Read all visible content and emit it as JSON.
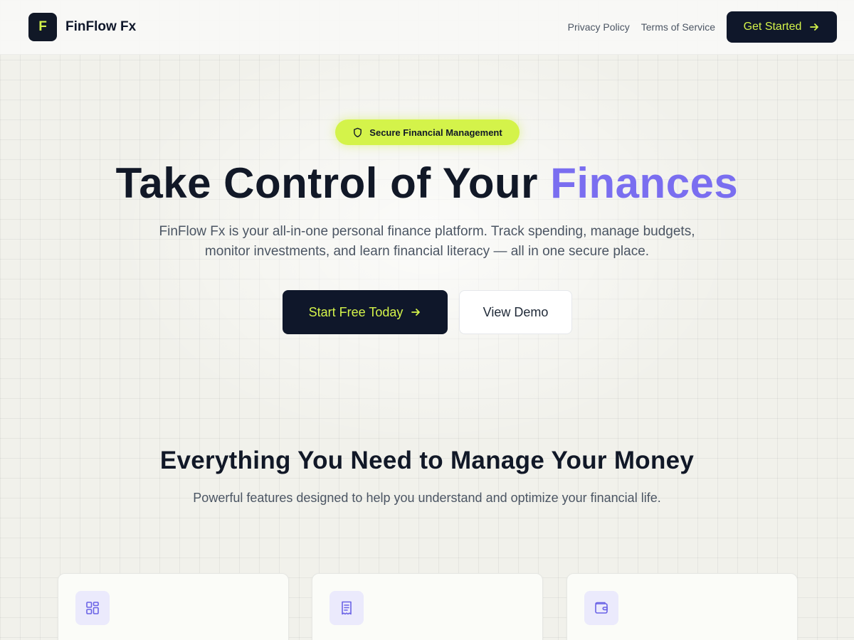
{
  "header": {
    "logo_letter": "F",
    "brand_name": "FinFlow Fx",
    "nav": [
      "Privacy Policy",
      "Terms of Service"
    ],
    "cta_label": "Get Started"
  },
  "hero": {
    "badge_label": "Secure Financial Management",
    "title_main": "Take Control of Your ",
    "title_accent": "Finances",
    "subtitle": "FinFlow Fx is your all-in-one personal finance platform. Track spending, manage budgets, monitor investments, and learn financial literacy — all in one secure place.",
    "primary_cta": "Start Free Today",
    "secondary_cta": "View Demo"
  },
  "features": {
    "title": "Everything You Need to Manage Your Money",
    "subtitle": "Powerful features designed to help you understand and optimize your financial life.",
    "cards": [
      {
        "icon": "dashboard-grid-icon"
      },
      {
        "icon": "receipt-icon"
      },
      {
        "icon": "wallet-icon"
      }
    ]
  },
  "colors": {
    "dark": "#0f172a",
    "lime": "#d4f34a",
    "accent_purple": "#7a6ef0",
    "icon_bg": "#ebeafc",
    "icon_stroke": "#6b63e6"
  }
}
